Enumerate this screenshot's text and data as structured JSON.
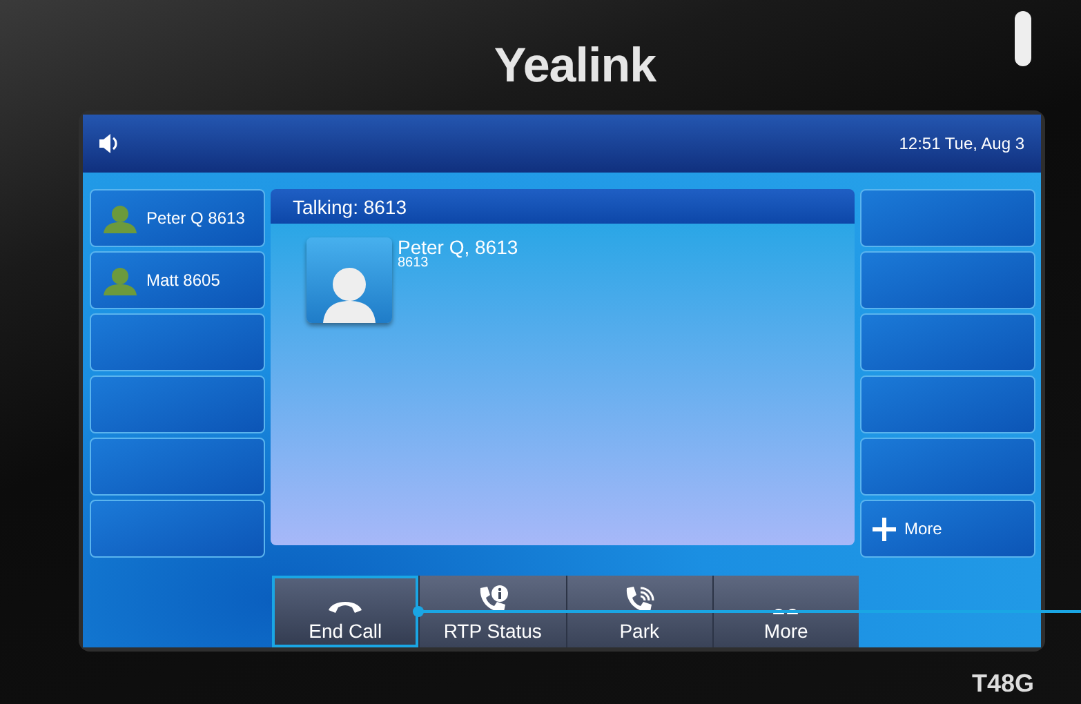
{
  "brand": "Yealink",
  "model": "T48G",
  "status_bar": {
    "time": "12:51 Tue, Aug 3"
  },
  "line_keys": [
    {
      "kind": "contact",
      "label": "Peter Q 8613"
    },
    {
      "kind": "contact",
      "label": "Matt 8605"
    },
    {
      "kind": "empty"
    },
    {
      "kind": "empty"
    },
    {
      "kind": "empty"
    },
    {
      "kind": "empty"
    }
  ],
  "call": {
    "title": "Talking: 8613",
    "name": "Peter Q, 8613",
    "number": "8613"
  },
  "dss_keys": [
    {
      "kind": "empty"
    },
    {
      "kind": "empty"
    },
    {
      "kind": "empty"
    },
    {
      "kind": "empty"
    },
    {
      "kind": "empty"
    },
    {
      "kind": "more",
      "label": "More"
    }
  ],
  "softkeys": [
    {
      "kind": "hangup",
      "label": "End Call",
      "selected": true
    },
    {
      "kind": "info",
      "label": "RTP Status",
      "selected": false
    },
    {
      "kind": "park",
      "label": "Park",
      "selected": false
    },
    {
      "kind": "dots",
      "label": "More",
      "selected": false
    }
  ]
}
